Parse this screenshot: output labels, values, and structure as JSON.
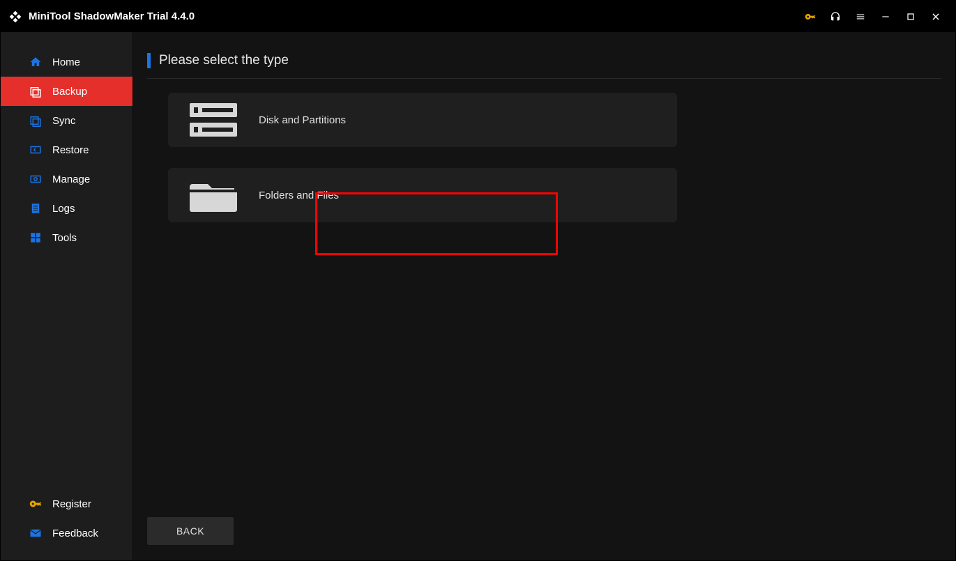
{
  "app": {
    "title": "MiniTool ShadowMaker Trial 4.4.0"
  },
  "sidebar": {
    "items": [
      {
        "label": "Home"
      },
      {
        "label": "Backup"
      },
      {
        "label": "Sync"
      },
      {
        "label": "Restore"
      },
      {
        "label": "Manage"
      },
      {
        "label": "Logs"
      },
      {
        "label": "Tools"
      }
    ],
    "bottom": [
      {
        "label": "Register"
      },
      {
        "label": "Feedback"
      }
    ]
  },
  "main": {
    "heading": "Please select the type",
    "options": [
      {
        "label": "Disk and Partitions"
      },
      {
        "label": "Folders and Files"
      }
    ],
    "back": "BACK"
  }
}
